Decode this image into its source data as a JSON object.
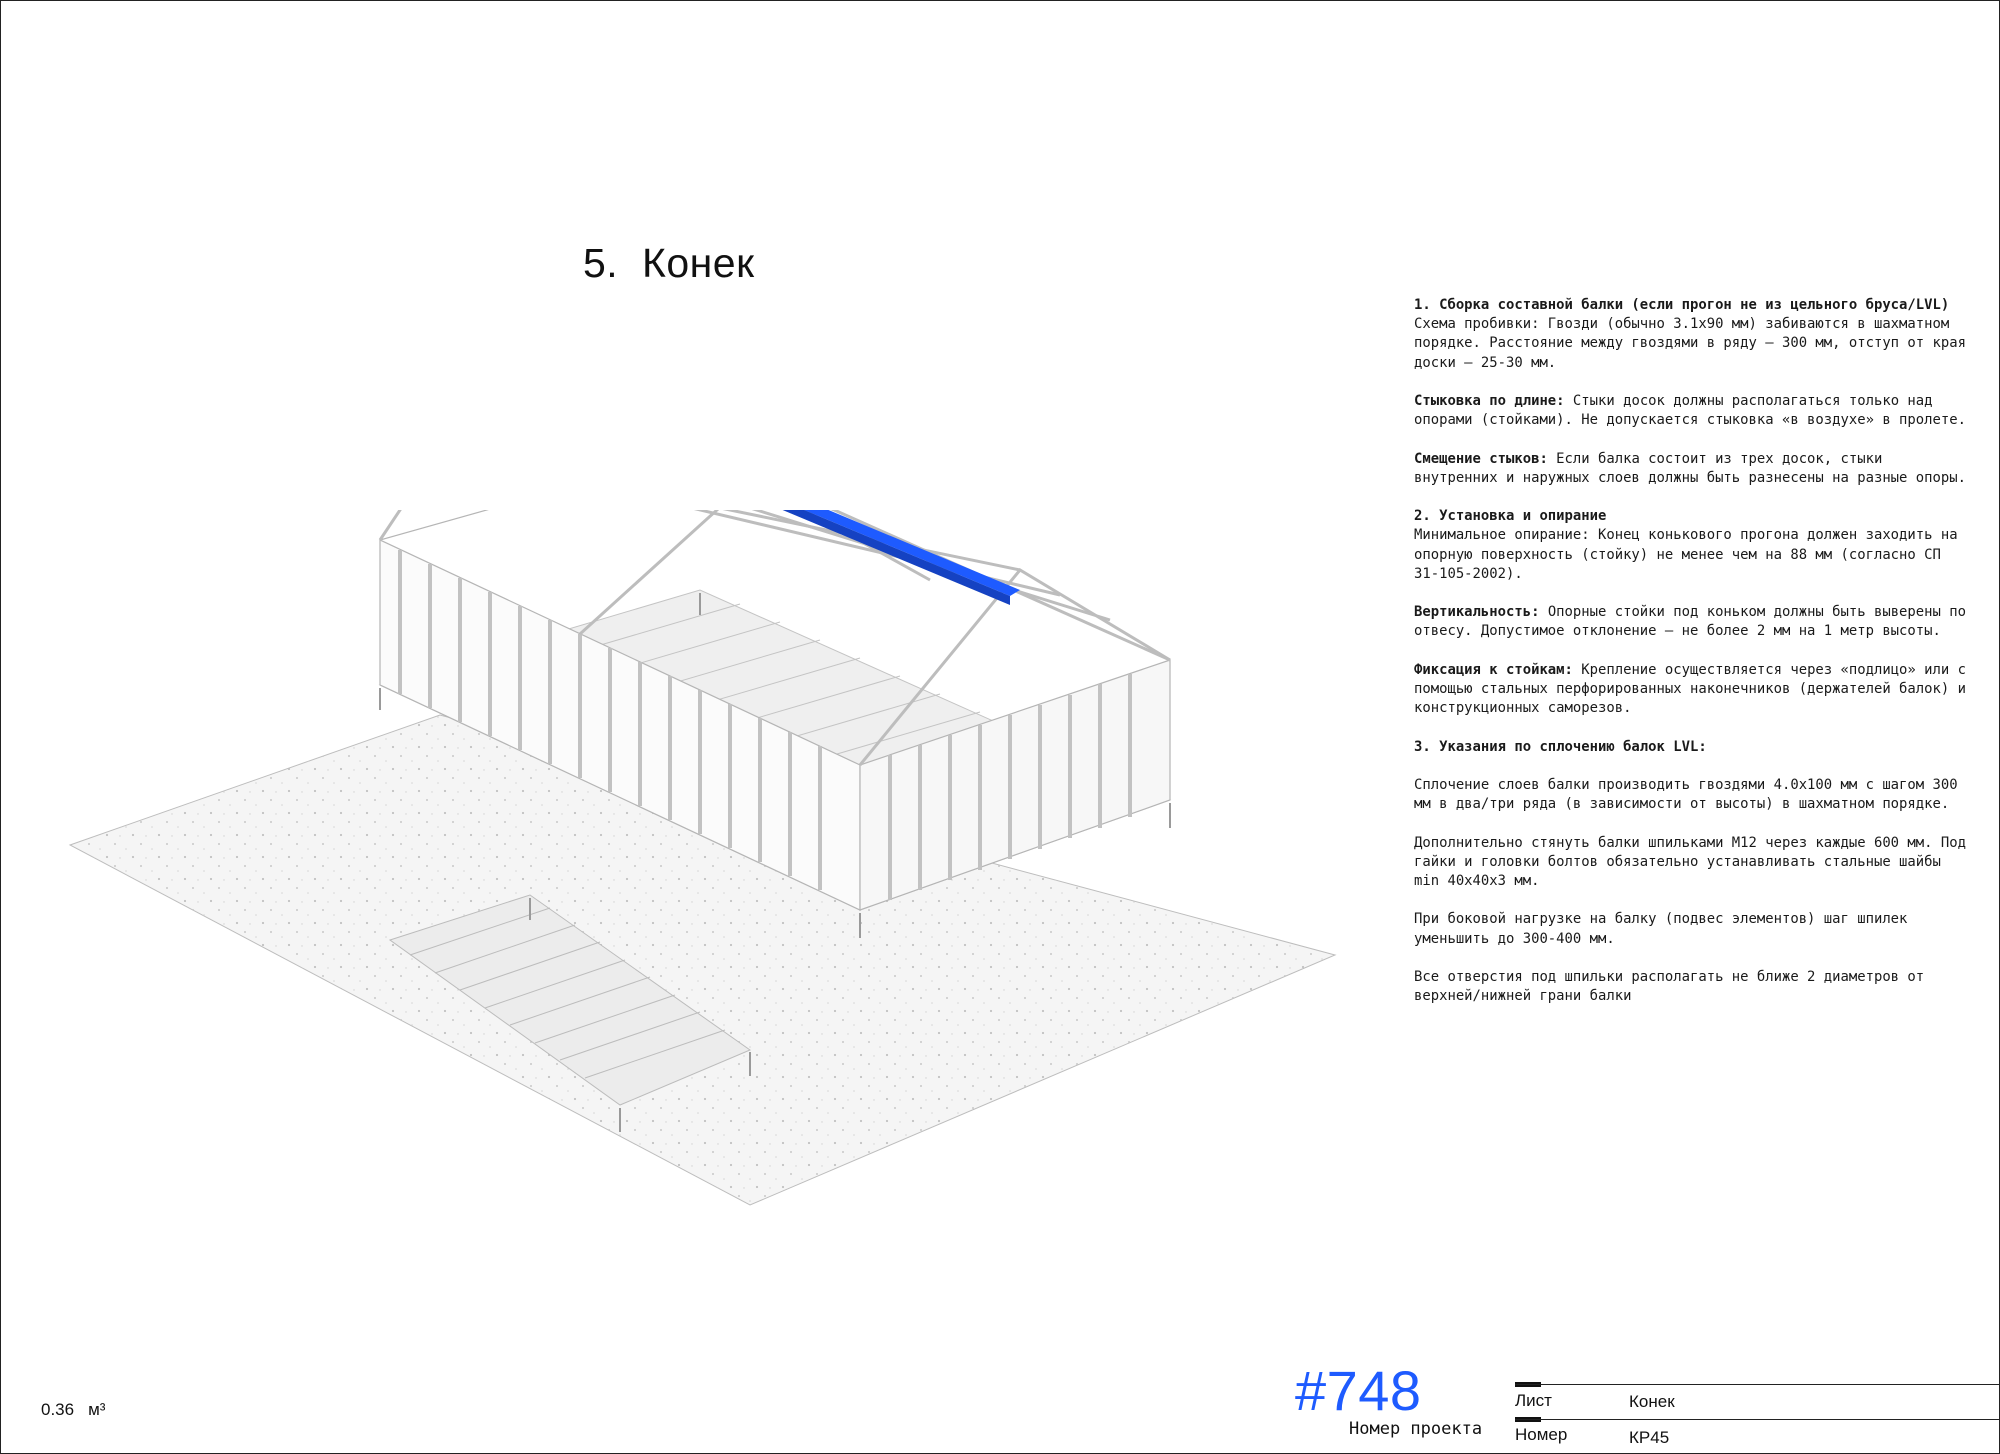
{
  "sheet_title": "5.  Конек",
  "notes": {
    "s1_heading": "1. Сборка составной балки (если прогон не из цельного бруса/LVL)",
    "s1_line1": "Схема пробивки: Гвозди (обычно 3.1х90 мм) забиваются в шахматном порядке. Расстояние между гвоздями в ряду — 300 мм, отступ от края доски — 25-30 мм.",
    "s1_p2_bold": "Стыковка по длине:",
    "s1_p2_text": " Стыки досок должны располагаться только над опорами (стойками). Не допускается стыковка «в воздухе» в пролете.",
    "s1_p3_bold": "Смещение стыков:",
    "s1_p3_text": " Если балка состоит из трех досок, стыки внутренних и наружных слоев должны быть разнесены на разные опоры.",
    "s2_heading": "2. Установка и опирание",
    "s2_line1": "Минимальное опирание: Конец конькового прогона должен заходить на опорную поверхность (стойку) не менее чем на 88 мм (согласно СП 31-105-2002).",
    "s2_p2_bold": "Вертикальность:",
    "s2_p2_text": " Опорные стойки под коньком должны быть выверены по отвесу. Допустимое отклонение — не более 2 мм на 1 метр высоты.",
    "s2_p3_bold": "Фиксация к стойкам:",
    "s2_p3_text": " Крепление осуществляется через «подлицо» или с помощью стальных перфорированных наконечников (держателей балок) и конструкционных саморезов.",
    "s3_heading": "3. Указания по сплочению балок LVL:",
    "s3_p1": "Сплочение слоев балки производить гвоздями 4.0х100 мм с шагом 300 мм в два/три ряда (в зависимости от высоты) в шахматном порядке.",
    "s3_p2": "Дополнительно стянуть балки шпильками М12 через каждые 600 мм. Под гайки и головки болтов обязательно устанавливать стальные шайбы min 40х40х3 мм.",
    "s3_p3": "При боковой нагрузке на балку (подвес элементов) шаг шпилек уменьшить до 300-400 мм.",
    "s3_p4": "Все отверстия под шпильки располагать не ближе 2 диаметров от верхней/нижней грани балки"
  },
  "volume": {
    "value": "0.36",
    "unit": "м³"
  },
  "project": {
    "number": "#748",
    "caption": "Номер проекта"
  },
  "title_block": {
    "sheet_label": "Лист",
    "sheet_value": "Конек",
    "number_label": "Номер",
    "number_value": "КР45"
  },
  "colors": {
    "accent": "#1e5bff",
    "frame": "#dcdcdc",
    "ground": "#f3f3f3"
  }
}
